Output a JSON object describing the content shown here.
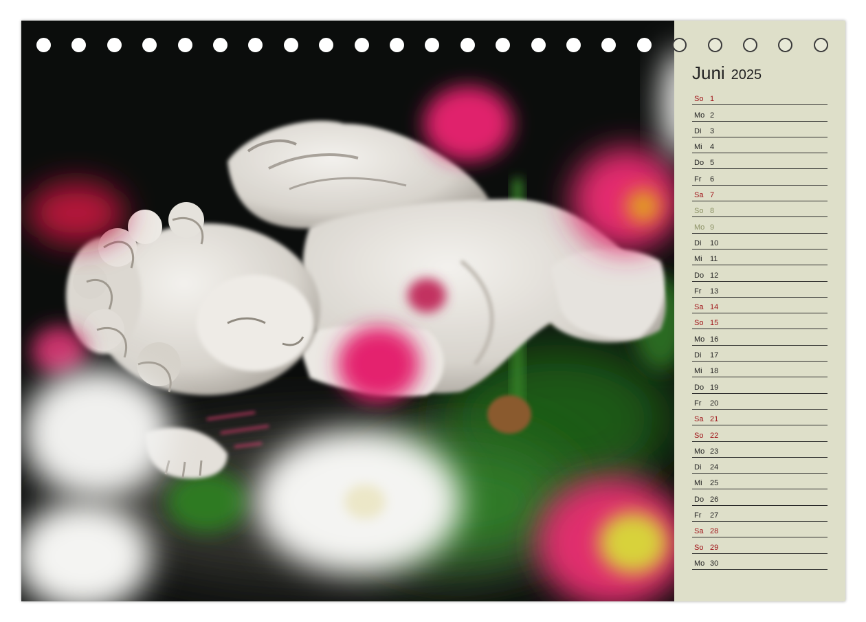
{
  "calendar": {
    "month": "Juni",
    "year": "2025",
    "colors": {
      "panel": "#dedfc9",
      "weekend": "#a01419",
      "holiday": "#8c9265",
      "text": "#222222"
    },
    "days": [
      {
        "wd": "So",
        "d": "1",
        "type": "sun"
      },
      {
        "wd": "Mo",
        "d": "2",
        "type": "normal"
      },
      {
        "wd": "Di",
        "d": "3",
        "type": "normal"
      },
      {
        "wd": "Mi",
        "d": "4",
        "type": "normal"
      },
      {
        "wd": "Do",
        "d": "5",
        "type": "normal"
      },
      {
        "wd": "Fr",
        "d": "6",
        "type": "normal"
      },
      {
        "wd": "Sa",
        "d": "7",
        "type": "sat"
      },
      {
        "wd": "So",
        "d": "8",
        "type": "holiday"
      },
      {
        "wd": "Mo",
        "d": "9",
        "type": "holiday"
      },
      {
        "wd": "Di",
        "d": "10",
        "type": "normal"
      },
      {
        "wd": "Mi",
        "d": "11",
        "type": "normal"
      },
      {
        "wd": "Do",
        "d": "12",
        "type": "normal"
      },
      {
        "wd": "Fr",
        "d": "13",
        "type": "normal"
      },
      {
        "wd": "Sa",
        "d": "14",
        "type": "sat"
      },
      {
        "wd": "So",
        "d": "15",
        "type": "sun"
      },
      {
        "wd": "Mo",
        "d": "16",
        "type": "normal"
      },
      {
        "wd": "Di",
        "d": "17",
        "type": "normal"
      },
      {
        "wd": "Mi",
        "d": "18",
        "type": "normal"
      },
      {
        "wd": "Do",
        "d": "19",
        "type": "normal"
      },
      {
        "wd": "Fr",
        "d": "20",
        "type": "normal"
      },
      {
        "wd": "Sa",
        "d": "21",
        "type": "sat"
      },
      {
        "wd": "So",
        "d": "22",
        "type": "sun"
      },
      {
        "wd": "Mo",
        "d": "23",
        "type": "normal"
      },
      {
        "wd": "Di",
        "d": "24",
        "type": "normal"
      },
      {
        "wd": "Mi",
        "d": "25",
        "type": "normal"
      },
      {
        "wd": "Do",
        "d": "26",
        "type": "normal"
      },
      {
        "wd": "Fr",
        "d": "27",
        "type": "normal"
      },
      {
        "wd": "Sa",
        "d": "28",
        "type": "sat"
      },
      {
        "wd": "So",
        "d": "29",
        "type": "sun"
      },
      {
        "wd": "Mo",
        "d": "30",
        "type": "normal"
      }
    ]
  },
  "photo": {
    "subject": "sleeping-angel-figurine",
    "colors": {
      "background": "#0b0d0c",
      "figurine": "#e9e6e1",
      "daisy_pink": "#e0246c",
      "daisy_white": "#f4f4f2",
      "daisy_center": "#d8d23a",
      "leaf_green": "#2f7a25"
    }
  },
  "binding": {
    "hole_count": 23,
    "holes_on_photo": 18
  }
}
